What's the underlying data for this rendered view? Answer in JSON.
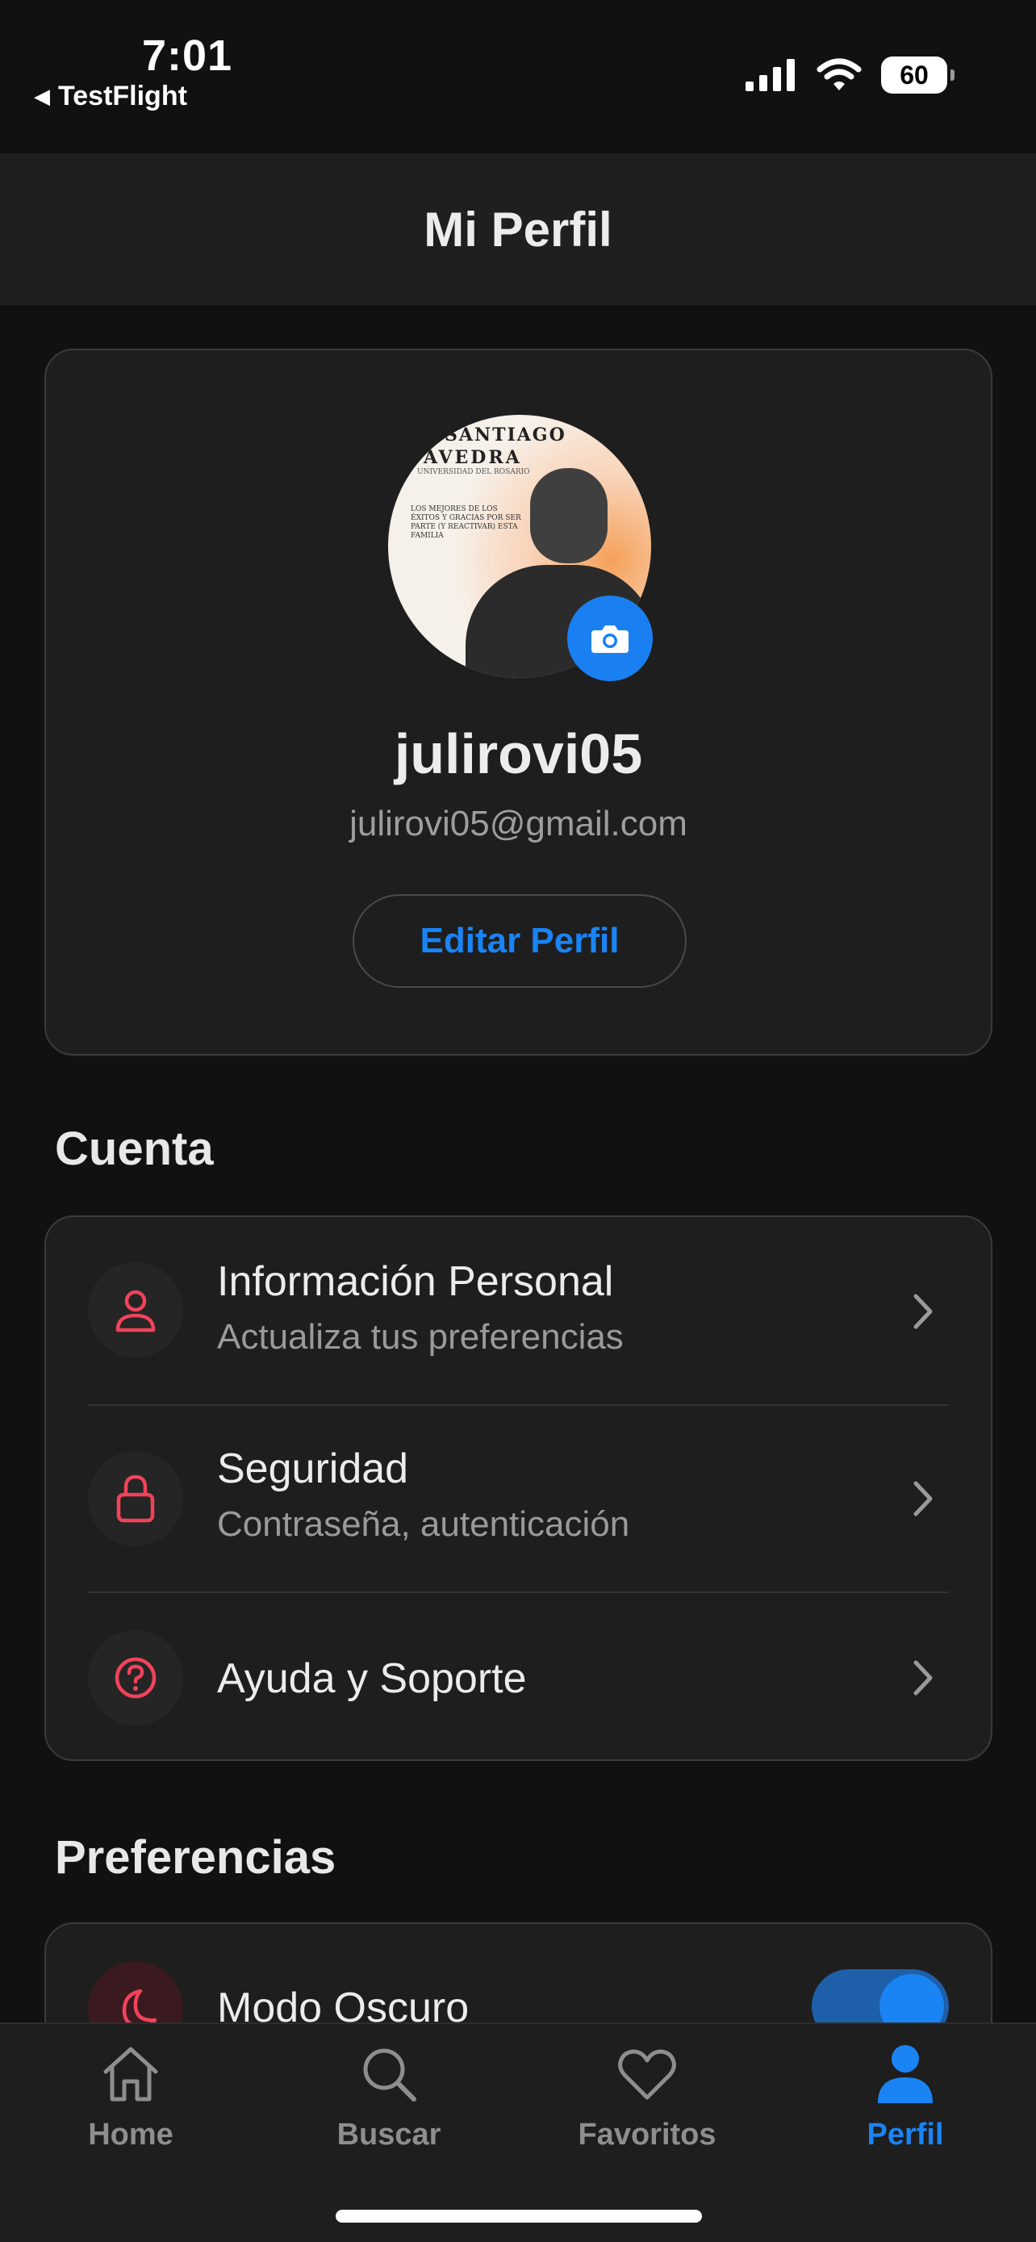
{
  "status_bar": {
    "time": "7:01",
    "back_app": "TestFlight",
    "battery": "60"
  },
  "header": {
    "title": "Mi Perfil"
  },
  "profile": {
    "avatar_text_line1": "SANTIAGO",
    "avatar_text_line2": "AVEDRA",
    "avatar_text_line3": "UNIVERSIDAD DEL ROSARIO",
    "avatar_text_line4": "LOS MEJORES DE LOS ÉXITOS Y GRACIAS POR SER PARTE (Y REACTIVAR) ESTA FAMILIA",
    "username": "julirovi05",
    "email": "julirovi05@gmail.com",
    "edit_button": "Editar Perfil"
  },
  "sections": {
    "account_title": "Cuenta",
    "preferences_title": "Preferencias"
  },
  "account_items": [
    {
      "title": "Información Personal",
      "subtitle": "Actualiza tus preferencias",
      "icon": "person-icon"
    },
    {
      "title": "Seguridad",
      "subtitle": "Contraseña, autenticación",
      "icon": "lock-icon"
    },
    {
      "title": "Ayuda y Soporte",
      "subtitle": "",
      "icon": "help-circle-icon"
    }
  ],
  "preference_items": [
    {
      "title": "Modo Oscuro",
      "icon": "moon-icon",
      "enabled": true
    }
  ],
  "tab_bar": {
    "tabs": [
      {
        "label": "Home",
        "icon": "home-icon",
        "active": false
      },
      {
        "label": "Buscar",
        "icon": "search-icon",
        "active": false
      },
      {
        "label": "Favoritos",
        "icon": "heart-icon",
        "active": false
      },
      {
        "label": "Perfil",
        "icon": "profile-icon",
        "active": true
      }
    ]
  },
  "colors": {
    "accent": "#1a84f5",
    "icon_red": "#f0435a",
    "background": "#111111",
    "card": "#1e1e1e"
  }
}
